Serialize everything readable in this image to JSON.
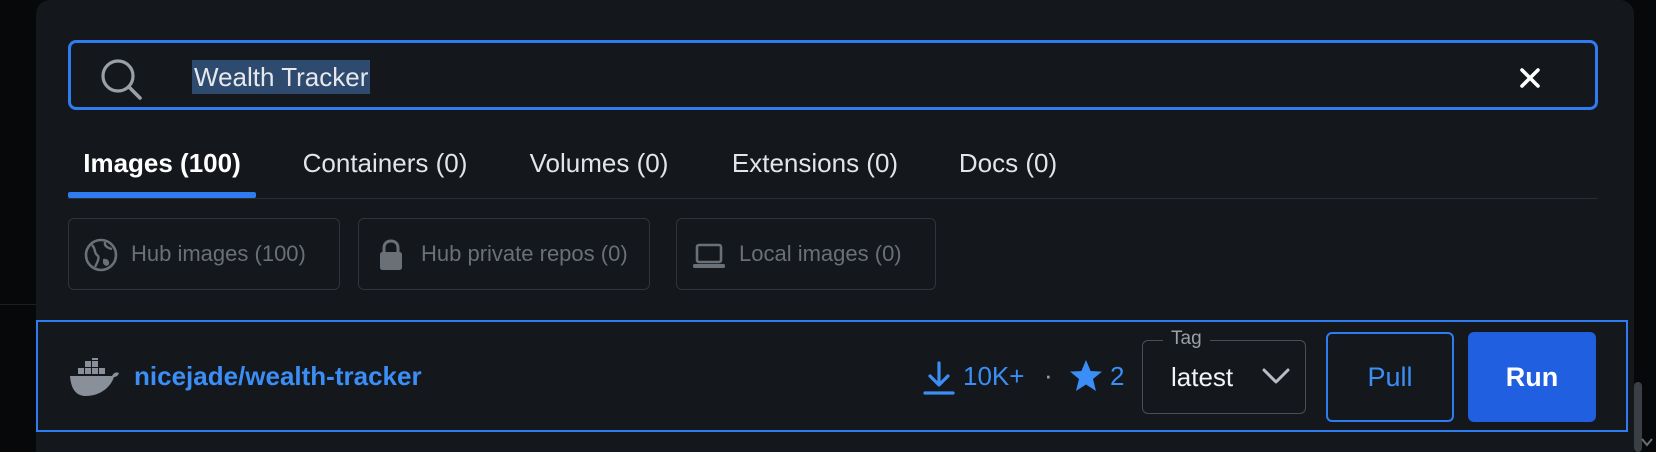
{
  "search": {
    "value": "Wealth Tracker"
  },
  "tabs": [
    {
      "label": "Images (100)",
      "active": true
    },
    {
      "label": "Containers (0)",
      "active": false
    },
    {
      "label": "Volumes (0)",
      "active": false
    },
    {
      "label": "Extensions (0)",
      "active": false
    },
    {
      "label": "Docs (0)",
      "active": false
    }
  ],
  "filters": [
    {
      "label": "Hub images (100)",
      "icon": "globe-icon"
    },
    {
      "label": "Hub private repos (0)",
      "icon": "lock-icon"
    },
    {
      "label": "Local images (0)",
      "icon": "laptop-icon"
    }
  ],
  "result": {
    "repo": "nicejade/wealth-tracker",
    "pulls": "10K+",
    "separator": "·",
    "stars": "2",
    "tag_label": "Tag",
    "tag_value": "latest",
    "pull_label": "Pull",
    "run_label": "Run"
  },
  "colors": {
    "accent": "#2f7bf0",
    "link": "#3b8ef5",
    "run_button": "#1f5fe0",
    "background": "#14171b"
  }
}
